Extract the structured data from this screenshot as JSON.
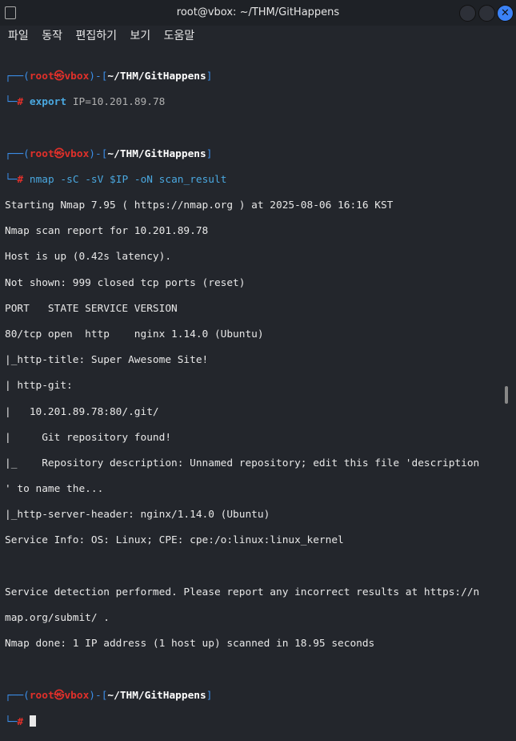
{
  "window": {
    "title": "root@vbox: ~/THM/GitHappens"
  },
  "menu": [
    "파일",
    "동작",
    "편집하기",
    "보기",
    "도움말"
  ],
  "prompt": {
    "user": "root",
    "host": "vbox",
    "path": "~/THM/GitHappens",
    "symbol": "㉿"
  },
  "commands": [
    {
      "cmd": "export",
      "args": "IP=10.201.89.78"
    },
    {
      "cmd": "nmap",
      "args": "-sC -sV $IP -oN scan_result"
    }
  ],
  "output": [
    "Starting Nmap 7.95 ( https://nmap.org ) at 2025-08-06 16:16 KST",
    "Nmap scan report for 10.201.89.78",
    "Host is up (0.42s latency).",
    "Not shown: 999 closed tcp ports (reset)",
    "PORT   STATE SERVICE VERSION",
    "80/tcp open  http    nginx 1.14.0 (Ubuntu)",
    "|_http-title: Super Awesome Site!",
    "| http-git: ",
    "|   10.201.89.78:80/.git/",
    "|     Git repository found!",
    "|_    Repository description: Unnamed repository; edit this file 'description",
    "' to name the...",
    "|_http-server-header: nginx/1.14.0 (Ubuntu)",
    "Service Info: OS: Linux; CPE: cpe:/o:linux:linux_kernel",
    "",
    "Service detection performed. Please report any incorrect results at https://n",
    "map.org/submit/ .",
    "Nmap done: 1 IP address (1 host up) scanned in 18.95 seconds"
  ]
}
